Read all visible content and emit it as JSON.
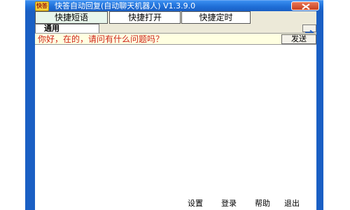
{
  "window": {
    "title": "快答自动回复(自动聊天机器人) V1.3.9.0",
    "icon_text": "快答"
  },
  "top_tabs": [
    {
      "label": "快捷短语",
      "active": true
    },
    {
      "label": "快捷打开",
      "active": false
    },
    {
      "label": "快捷定时",
      "active": false
    }
  ],
  "sub_tab": {
    "label": "通用"
  },
  "reply": {
    "text": "你好，在的，请问有什么问题吗？",
    "send_label": "发送"
  },
  "footer": {
    "settings": "设置",
    "login": "登录",
    "help": "帮助",
    "exit": "退出"
  },
  "colors": {
    "titlebar": "#1f6fd8",
    "reply_text": "#d0261b",
    "reply_bg": "#ffffe1",
    "active_tab_bg": "#e8f6ec"
  },
  "icons": {
    "close": "close-icon",
    "arrow": "arrow-right-icon",
    "app": "app-icon"
  }
}
